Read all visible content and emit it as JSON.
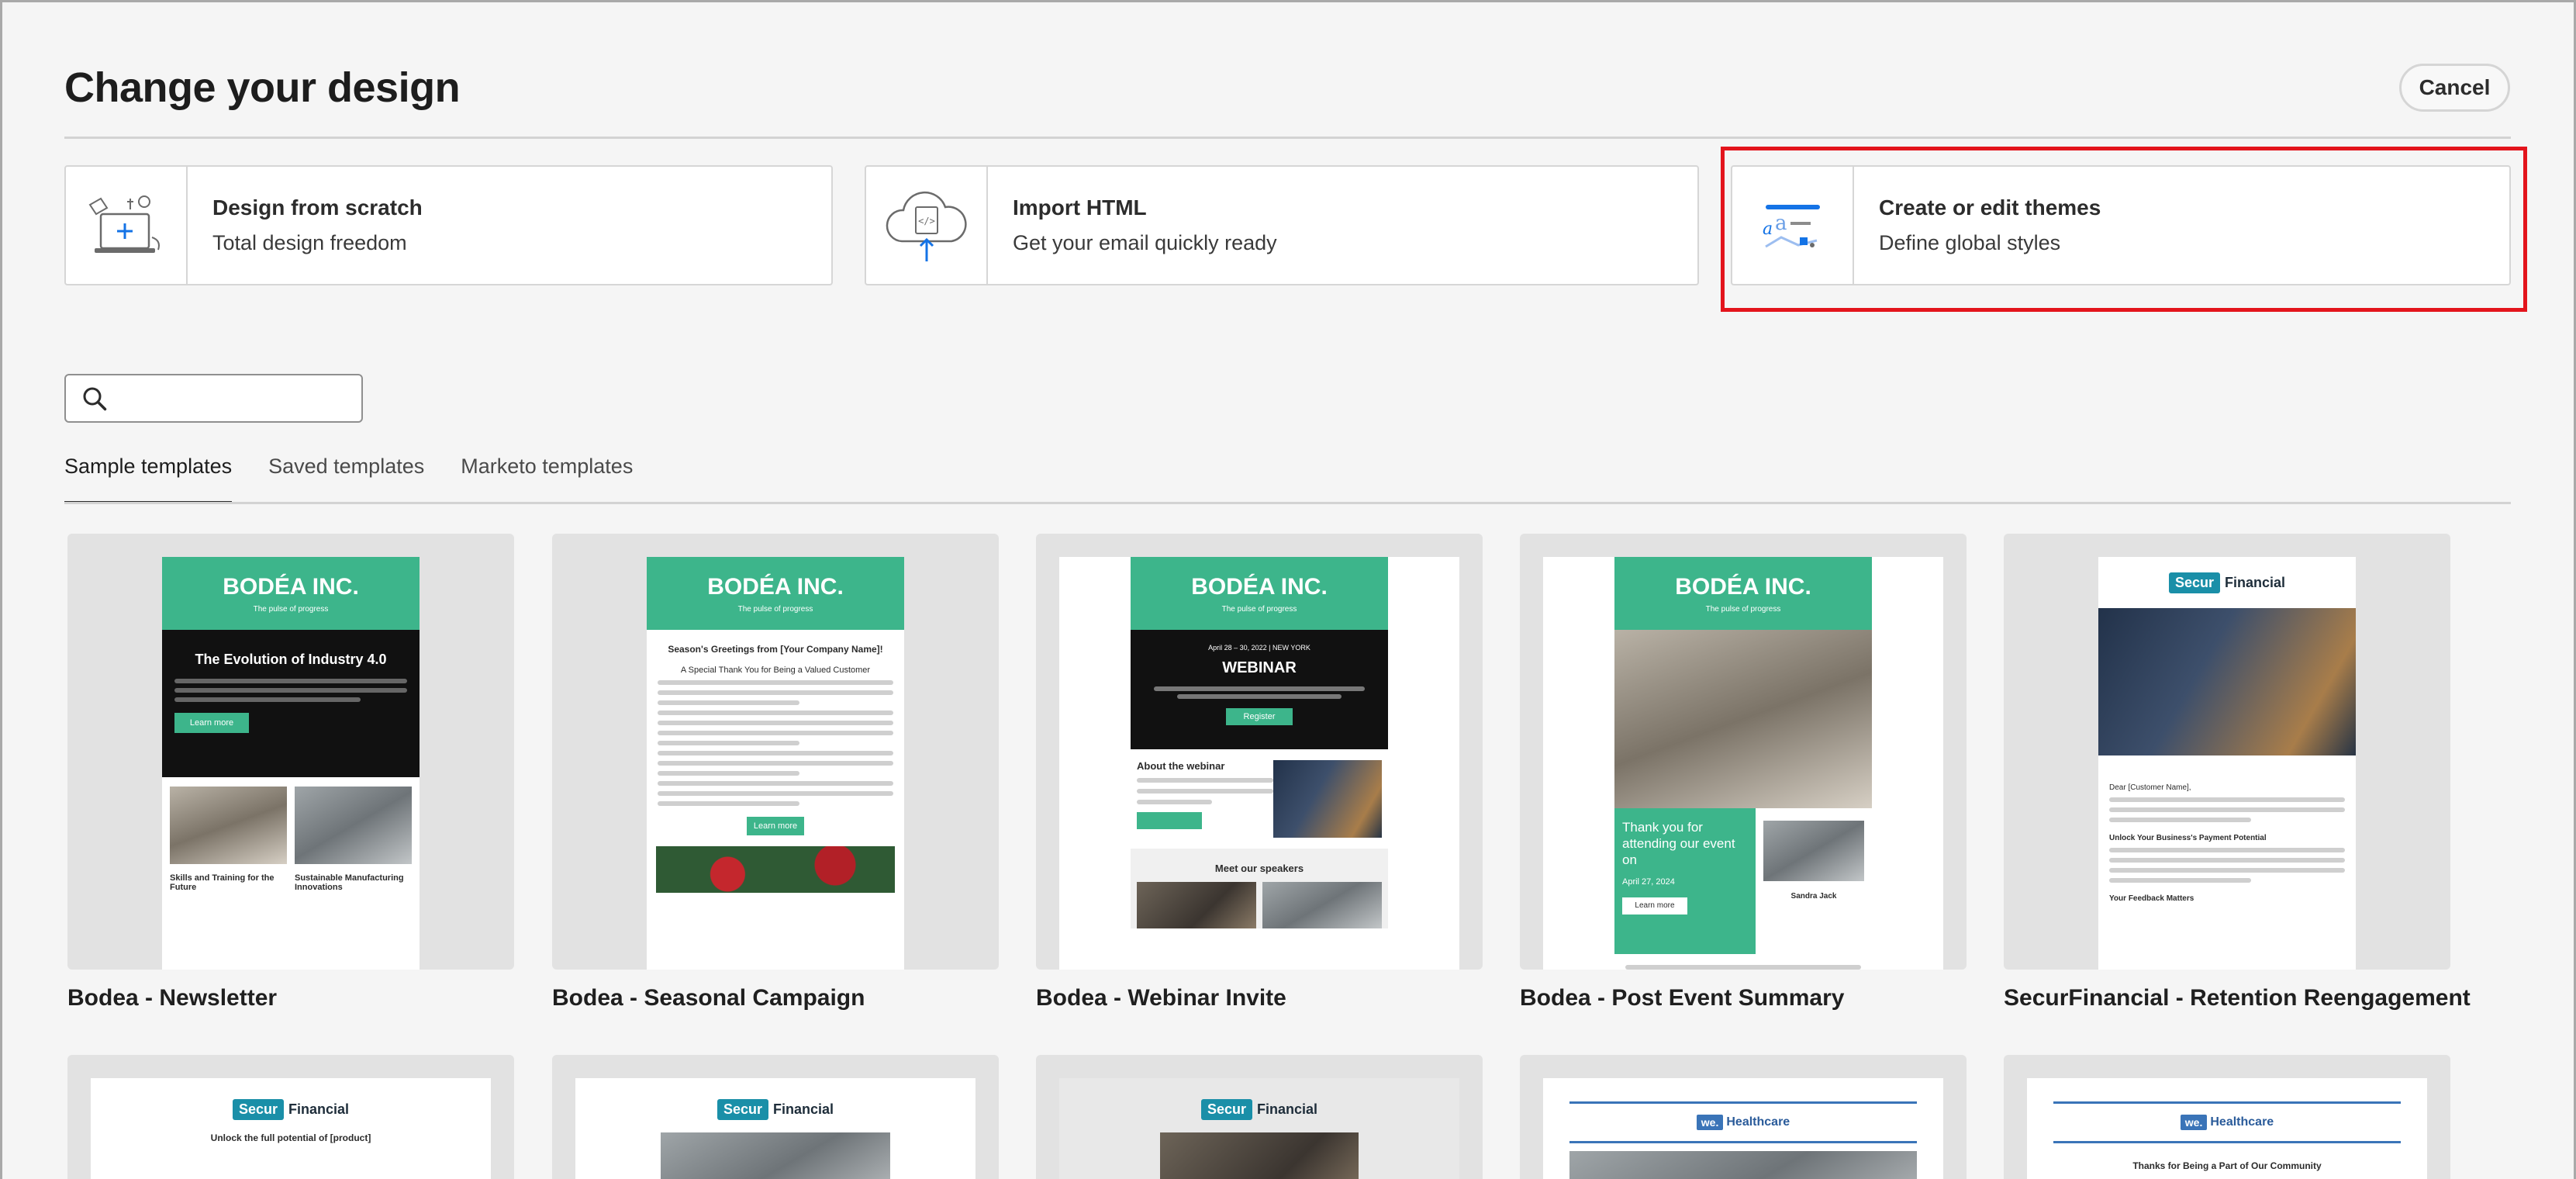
{
  "dialog": {
    "title": "Change your design",
    "cancel_label": "Cancel"
  },
  "options": [
    {
      "title": "Design from scratch",
      "subtitle": "Total design freedom",
      "icon": "design-scratch-icon"
    },
    {
      "title": "Import HTML",
      "subtitle": "Get your email quickly ready",
      "icon": "cloud-upload-code-icon"
    },
    {
      "title": "Create or edit themes",
      "subtitle": "Define global styles",
      "icon": "themes-icon"
    }
  ],
  "search": {
    "placeholder": "",
    "value": ""
  },
  "tabs": [
    {
      "label": "Sample templates",
      "active": true
    },
    {
      "label": "Saved templates",
      "active": false
    },
    {
      "label": "Marketo templates",
      "active": false
    }
  ],
  "templates": [
    {
      "name": "Bodea - Newsletter"
    },
    {
      "name": "Bodea - Seasonal Campaign"
    },
    {
      "name": "Bodea - Webinar Invite"
    },
    {
      "name": "Bodea - Post Event Summary"
    },
    {
      "name": "SecurFinancial - Retention Reengagement"
    }
  ],
  "thumbs": {
    "bodea_brand": "BODÉA INC.",
    "bodea_tagline": "The pulse of progress",
    "newsletter_heading": "The Evolution of Industry 4.0",
    "newsletter_col1": "Skills and Training for the Future",
    "newsletter_col2": "Sustainable Manufacturing Innovations",
    "newsletter_btn": "Learn more",
    "seasonal_heading": "Season's Greetings from [Your Company Name]!",
    "seasonal_sub": "A Special Thank You for Being a Valued Customer",
    "seasonal_btn": "Learn more",
    "webinar_date": "April 28 – 30, 2022 | NEW YORK",
    "webinar_heading": "WEBINAR",
    "webinar_btn": "Register",
    "webinar_about": "About the webinar",
    "webinar_speakers": "Meet our speakers",
    "post_heading": "Thank you for attending our event on",
    "post_date": "April 27, 2024",
    "post_btn": "Learn more",
    "post_name": "Sandra Jack",
    "secur_brand_box": "Secur",
    "secur_brand_text": "Financial",
    "secur_greeting": "Dear [Customer Name],",
    "secur_unlock": "Unlock Your Business's Payment Potential",
    "secur_feedback": "Your Feedback Matters",
    "secur_row2_heading": "Unlock the full potential of [product]",
    "we_box": "we.",
    "we_text": "Healthcare",
    "we_row2_heading": "Thanks for Being a Part of Our Community"
  },
  "colors": {
    "accent_green": "#3db58b",
    "highlight_red": "#e3141c",
    "secur_teal": "#1a8fa8",
    "we_blue": "#3a74b8"
  }
}
